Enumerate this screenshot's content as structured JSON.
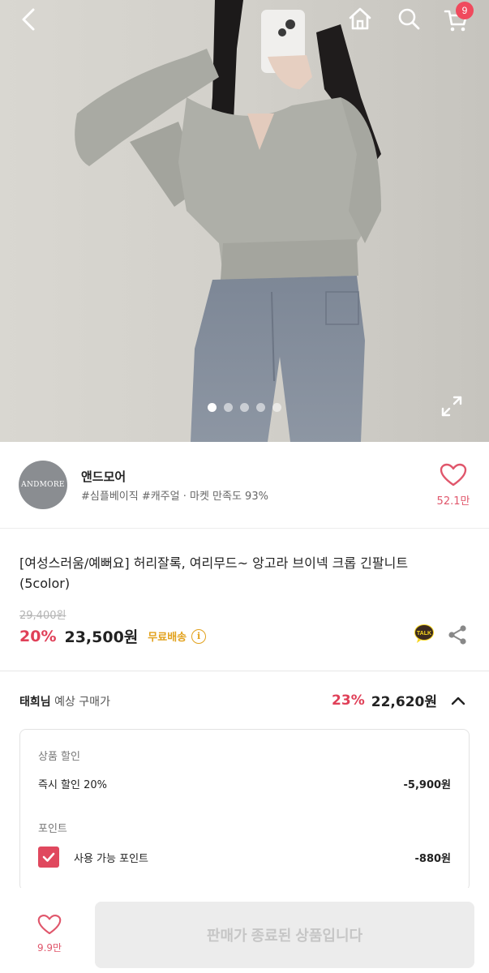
{
  "header": {
    "cart_count": "9",
    "icons": [
      "back-arrow-icon",
      "home-icon",
      "search-icon",
      "cart-icon"
    ]
  },
  "gallery": {
    "image_count": 5,
    "active_index": 0,
    "expand_icon": "expand-icon"
  },
  "store": {
    "logo_text": "ANDMORE",
    "name": "앤드모어",
    "tags": "#심플베이직 #캐주얼 · 마켓 만족도 93%",
    "likes": "52.1만"
  },
  "product": {
    "title": "[여성스러움/예뻐요] 허리잘록, 여리무드~ 앙고라 브이넥 크롭 긴팔니트 (5color)",
    "original_price": "29,400원",
    "discount": "20%",
    "price": "23,500원",
    "shipping": "무료배송",
    "info_symbol": "i",
    "talk_label": "TALK"
  },
  "expected": {
    "user": "태희님",
    "label": "예상 구매가",
    "discount": "23%",
    "price": "22,620원"
  },
  "breakdown": {
    "discount_section": "상품 할인",
    "instant_label": "즉시 할인 20%",
    "instant_amount": "-5,900원",
    "point_section": "포인트",
    "point_label": "사용 가능 포인트",
    "point_amount": "-880원",
    "point_checked": true
  },
  "bottom": {
    "likes": "9.9만",
    "buy_label": "판매가 종료된 상품입니다"
  },
  "colors": {
    "accent": "#e04058",
    "shipping": "#e2a11c",
    "disabled_bg": "#ececec"
  }
}
